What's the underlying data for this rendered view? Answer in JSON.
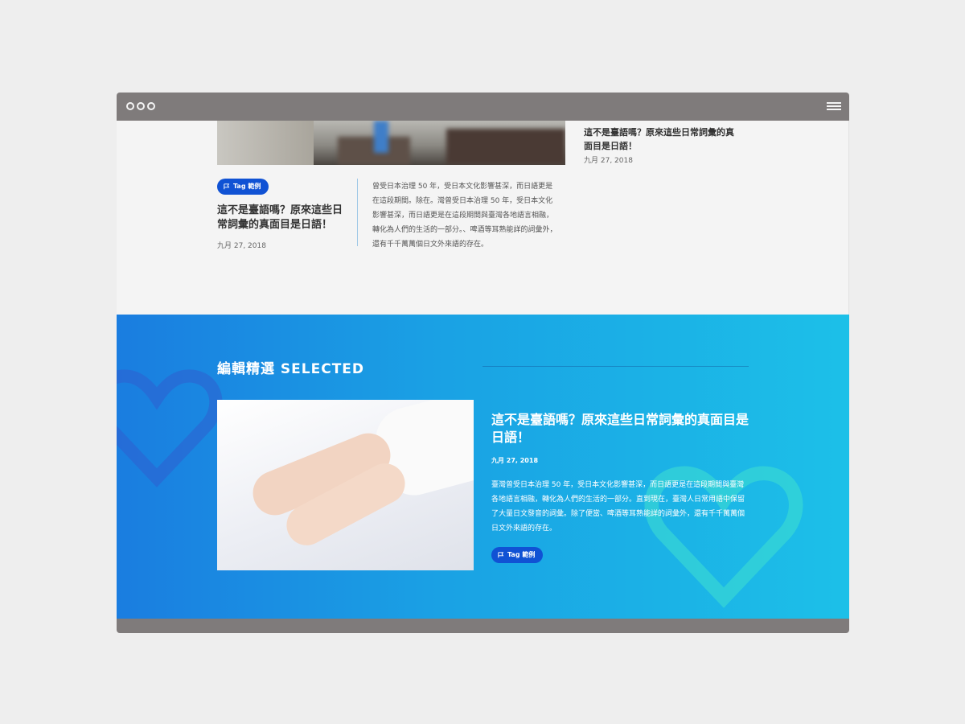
{
  "window": {
    "title": ""
  },
  "recent": {
    "side_item": {
      "title": "這不是臺語嗎？原來這些日常詞彙的真面目是日語！",
      "date": "九月 27, 2018"
    },
    "article": {
      "tag": "Tag 範例",
      "title": "這不是臺語嗎？原來這些日常詞彙的真面目是日語！",
      "date": "九月 27, 2018",
      "excerpt": "曾受日本治理 50 年，受日本文化影響甚深，而日語更是在這段期間。除在。灣曾受日本治理 50 年，受日本文化影響甚深，而日語更是在這段期間與臺灣各地語言相融，轉化為人們的生活的一部分。、啤酒等耳熟能詳的詞彙外，還有千千萬萬個日文外來語的存在。"
    }
  },
  "selected": {
    "heading": "編輯精選  SELECTED",
    "article": {
      "title": "這不是臺語嗎？原來這些日常詞彙的真面目是日語！",
      "date": "九月 27, 2018",
      "excerpt": "臺灣曾受日本治理 50 年，受日本文化影響甚深，而日語更是在這段期間與臺灣各地語言相融，轉化為人們的生活的一部分。直到現在，臺灣人日常用語中保留了大量日文發音的詞彙。除了便當、啤酒等耳熟能詳的詞彙外，還有千千萬萬個日文外來語的存在。",
      "tag": "Tag 範例"
    }
  },
  "colors": {
    "tag": "#1052d4",
    "frame": "#7f7b7b",
    "blue_start": "#1a7de0",
    "blue_end": "#1cc0e8"
  },
  "icons": {
    "tag_icon": "flag-icon",
    "menu_icon": "hamburger-icon"
  }
}
